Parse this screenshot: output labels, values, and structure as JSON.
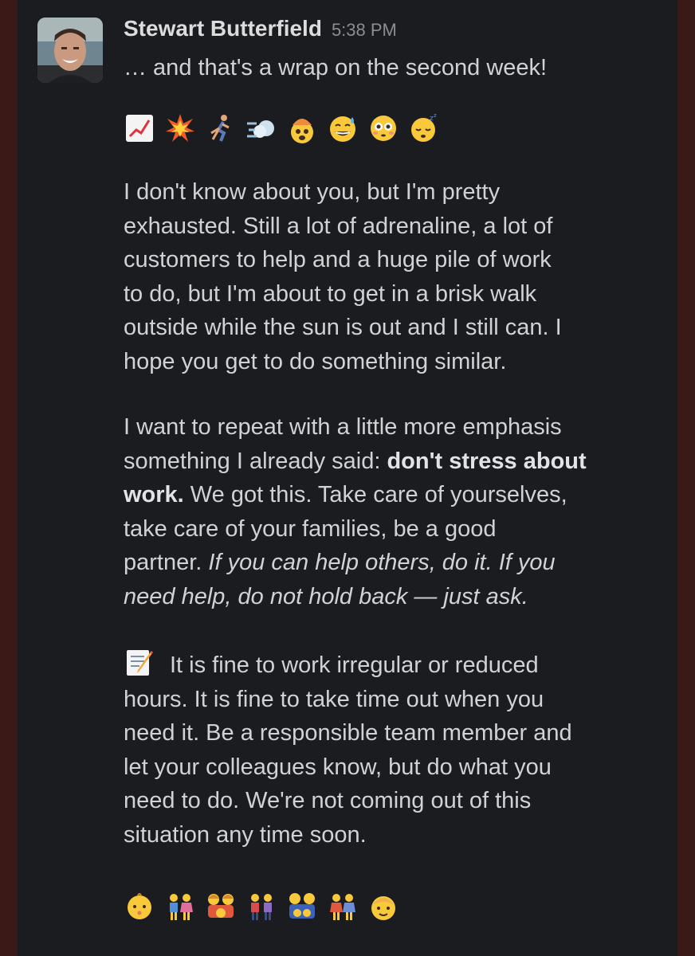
{
  "message": {
    "author": "Stewart Butterfield",
    "timestamp": "5:38 PM",
    "first_line": "… and that's a wrap on the second week!",
    "top_emojis": [
      "chart-increasing-icon",
      "collision-icon",
      "running-person-icon",
      "dashing-away-icon",
      "exploding-head-icon",
      "sweat-smile-icon",
      "flushed-face-icon",
      "sleeping-face-icon"
    ],
    "para1": [
      "I don't know about you, but I'm pretty",
      "exhausted. Still a lot of adrenaline, a lot of",
      "customers to help and a huge pile of work",
      "to do, but I'm about to get in a brisk walk",
      "outside while the sun is out and I still can. I",
      "hope you get to do something similar."
    ],
    "para2": {
      "l1": "I want to repeat with a little more emphasis",
      "l2_plain": "something I already said: ",
      "l2_bold": "don't stress about",
      "l3_bold": "work.",
      "l3_plain": " We got this. Take care of yourselves,",
      "l4": "take care of your families, be a good",
      "l5_plain": "partner. ",
      "l5_italic": "If you can help others, do it. If you",
      "l6_italic": "need help, do not hold back — just ask."
    },
    "para3": [
      "It is fine to work irregular or reduced",
      "hours. It is fine to take time out when you",
      "need it. Be a responsible team member and",
      "let your colleagues know, but do what you",
      "need to do. We're not coming out of this",
      "situation any time soon."
    ],
    "para3_emoji": "memo-icon",
    "bottom_emojis": [
      "baby-icon",
      "couple-icon",
      "family-icon",
      "couple-men-icon",
      "family-two-icon",
      "couple-women-icon",
      "child-icon"
    ]
  }
}
